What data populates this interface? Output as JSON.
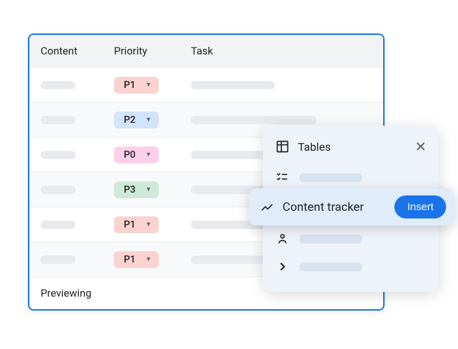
{
  "table": {
    "headers": {
      "content": "Content",
      "priority": "Priority",
      "task": "Task"
    },
    "rows": [
      {
        "priority": "P1",
        "priorityClass": "p1"
      },
      {
        "priority": "P2",
        "priorityClass": "p2"
      },
      {
        "priority": "P0",
        "priorityClass": "p0"
      },
      {
        "priority": "P3",
        "priorityClass": "p3"
      },
      {
        "priority": "P1",
        "priorityClass": "p1"
      },
      {
        "priority": "P1",
        "priorityClass": "p1"
      }
    ],
    "previewing": "Previewing"
  },
  "popup": {
    "title": "Tables",
    "active_item": "Content tracker",
    "insert_label": "Insert"
  }
}
